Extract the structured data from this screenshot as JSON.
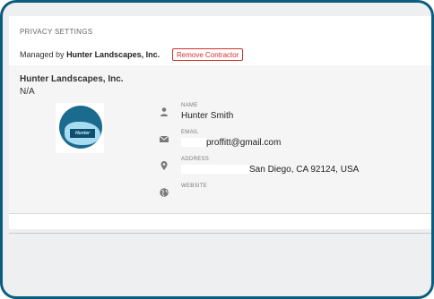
{
  "header": {
    "title": "PRIVACY SETTINGS"
  },
  "managed": {
    "prefix": "Managed by",
    "company": "Hunter Landscapes, Inc.",
    "remove_button": "Remove Contractor"
  },
  "company": {
    "name": "Hunter Landscapes, Inc.",
    "subtitle": "N/A",
    "logo_text": "Hunter"
  },
  "fields": {
    "name": {
      "label": "NAME",
      "value": "Hunter Smith",
      "icon": "person-icon"
    },
    "email": {
      "label": "EMAIL",
      "value": "proffitt@gmail.com",
      "icon": "envelope-icon"
    },
    "address": {
      "label": "ADDRESS",
      "value": "San Diego, CA 92124, USA",
      "icon": "map-pin-icon"
    },
    "website": {
      "label": "WEBSITE",
      "value": "",
      "icon": "globe-icon"
    }
  },
  "colors": {
    "frame_border": "#0b5c7e",
    "danger": "#d0312d",
    "logo_primary": "#1b6b8f"
  }
}
